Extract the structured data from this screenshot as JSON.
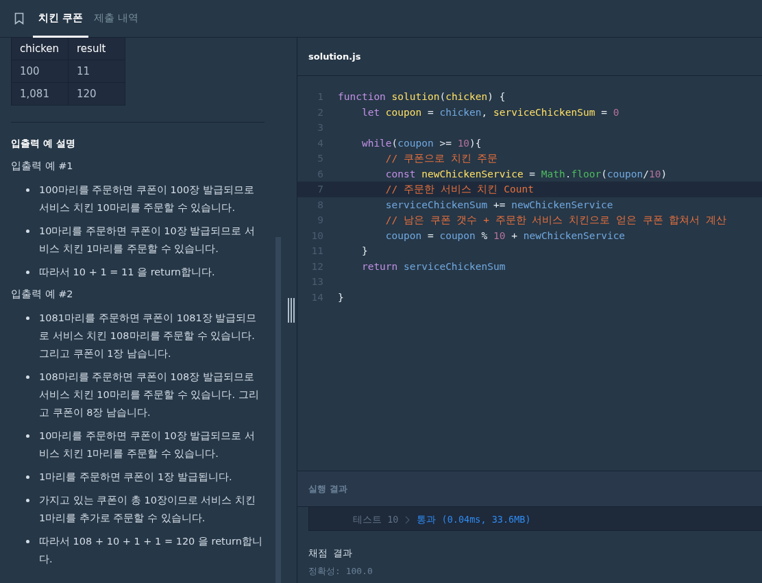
{
  "header": {
    "tabs": [
      {
        "label": "치킨 쿠폰",
        "selected": true
      },
      {
        "label": "제출 내역",
        "selected": false
      }
    ]
  },
  "example_table": {
    "columns": [
      "chicken",
      "result"
    ],
    "rows": [
      [
        "100",
        "11"
      ],
      [
        "1,081",
        "120"
      ]
    ]
  },
  "explanation": {
    "title": "입출력 예 설명",
    "sections": [
      {
        "heading": "입출력 예 #1",
        "bullets": [
          "100마리를 주문하면 쿠폰이 100장 발급되므로 서비스 치킨 10마리를 주문할 수 있습니다.",
          "10마리를 주문하면 쿠폰이 10장 발급되므로 서비스 치킨 1마리를 주문할 수 있습니다.",
          "따라서 10 + 1 = 11 을 return합니다."
        ]
      },
      {
        "heading": "입출력 예 #2",
        "bullets": [
          "1081마리를 주문하면 쿠폰이 1081장 발급되므로 서비스 치킨 108마리를 주문할 수 있습니다. 그리고 쿠폰이 1장 남습니다.",
          "108마리를 주문하면 쿠폰이 108장 발급되므로 서비스 치킨 10마리를 주문할 수 있습니다. 그리고 쿠폰이 8장 남습니다.",
          "10마리를 주문하면 쿠폰이 10장 발급되므로 서비스 치킨 1마리를 주문할 수 있습니다.",
          "1마리를 주문하면 쿠폰이 1장 발급됩니다.",
          "가지고 있는 쿠폰이 총 10장이므로 서비스 치킨 1마리를 추가로 주문할 수 있습니다.",
          "따라서 108 + 10 + 1 + 1 = 120 을 return합니다."
        ]
      }
    ]
  },
  "editor": {
    "file_name": "solution.js",
    "lines": [
      {
        "number": "1",
        "active": false,
        "tokens": [
          {
            "kind": "kw",
            "text": "function "
          },
          {
            "kind": "fn",
            "text": "solution"
          },
          {
            "kind": "plain",
            "text": "("
          },
          {
            "kind": "fn",
            "text": "chicken"
          },
          {
            "kind": "plain",
            "text": ") {"
          }
        ]
      },
      {
        "number": "2",
        "active": false,
        "tokens": [
          {
            "kind": "kw",
            "text": "    let "
          },
          {
            "kind": "fn",
            "text": "coupon"
          },
          {
            "kind": "plain",
            "text": " = "
          },
          {
            "kind": "var",
            "text": "chicken"
          },
          {
            "kind": "plain",
            "text": ", "
          },
          {
            "kind": "fn",
            "text": "serviceChickenSum"
          },
          {
            "kind": "plain",
            "text": " = "
          },
          {
            "kind": "num",
            "text": "0"
          }
        ]
      },
      {
        "number": "3",
        "active": false
      },
      {
        "number": "4",
        "active": false,
        "tokens": [
          {
            "kind": "kw",
            "text": "    while"
          },
          {
            "kind": "plain",
            "text": "("
          },
          {
            "kind": "var",
            "text": "coupon"
          },
          {
            "kind": "plain",
            "text": " >= "
          },
          {
            "kind": "num",
            "text": "10"
          },
          {
            "kind": "plain",
            "text": "){"
          }
        ]
      },
      {
        "number": "5",
        "active": false,
        "tokens": [
          {
            "kind": "comment",
            "text": "        // 쿠폰으로 치킨 주문"
          }
        ]
      },
      {
        "number": "6",
        "active": false,
        "tokens": [
          {
            "kind": "kw",
            "text": "        const "
          },
          {
            "kind": "fn",
            "text": "newChickenService"
          },
          {
            "kind": "plain",
            "text": " = "
          },
          {
            "kind": "cls",
            "text": "Math"
          },
          {
            "kind": "plain",
            "text": "."
          },
          {
            "kind": "cls",
            "text": "floor"
          },
          {
            "kind": "plain",
            "text": "("
          },
          {
            "kind": "var",
            "text": "coupon"
          },
          {
            "kind": "plain",
            "text": "/"
          },
          {
            "kind": "num",
            "text": "10"
          },
          {
            "kind": "plain",
            "text": ")"
          }
        ]
      },
      {
        "number": "7",
        "active": true,
        "tokens": [
          {
            "kind": "comment",
            "text": "        // 주문한 서비스 치킨 Count"
          }
        ]
      },
      {
        "number": "8",
        "active": false,
        "tokens": [
          {
            "kind": "var",
            "text": "        serviceChickenSum"
          },
          {
            "kind": "plain",
            "text": " += "
          },
          {
            "kind": "var",
            "text": "newChickenService"
          }
        ]
      },
      {
        "number": "9",
        "active": false,
        "tokens": [
          {
            "kind": "comment",
            "text": "        // 남은 쿠폰 갯수 + 주문한 서비스 치킨으로 얻은 쿠폰 합쳐서 계산"
          }
        ]
      },
      {
        "number": "10",
        "active": false,
        "tokens": [
          {
            "kind": "var",
            "text": "        coupon"
          },
          {
            "kind": "plain",
            "text": " = "
          },
          {
            "kind": "var",
            "text": "coupon"
          },
          {
            "kind": "plain",
            "text": " % "
          },
          {
            "kind": "num",
            "text": "10"
          },
          {
            "kind": "plain",
            "text": " + "
          },
          {
            "kind": "var",
            "text": "newChickenService"
          }
        ]
      },
      {
        "number": "11",
        "active": false,
        "tokens": [
          {
            "kind": "plain",
            "text": "    }"
          }
        ]
      },
      {
        "number": "12",
        "active": false,
        "tokens": [
          {
            "kind": "kw",
            "text": "    return "
          },
          {
            "kind": "var",
            "text": "serviceChickenSum"
          }
        ]
      },
      {
        "number": "13",
        "active": false
      },
      {
        "number": "14",
        "active": false,
        "tokens": [
          {
            "kind": "plain",
            "text": "}"
          }
        ]
      }
    ]
  },
  "results": {
    "title": "실행 결과",
    "tests": [
      {
        "label": "테스트 10",
        "result": "통과 (0.04ms, 33.6MB)"
      }
    ],
    "grading_title": "채점 결과",
    "accuracy": "정확성: 100.0"
  }
}
